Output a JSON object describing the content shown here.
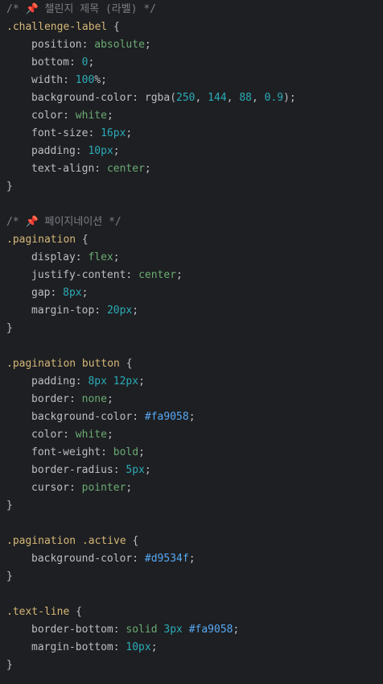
{
  "code": {
    "c1_open": "/* ",
    "c1_pin": "📌",
    "c1_text": " 챌린지 제목 (라벨) */",
    "sel1": ".challenge-label",
    "p_position": "position",
    "v_absolute": "absolute",
    "p_bottom": "bottom",
    "v_zero": "0",
    "p_width": "width",
    "v_100": "100",
    "v_pct": "%",
    "p_bgc": "background-color",
    "v_rgba": "rgba",
    "v_250": "250",
    "v_144": "144",
    "v_88": "88",
    "v_09": "0.9",
    "p_color": "color",
    "v_white": "white",
    "p_fontsize": "font-size",
    "v_16px": "16px",
    "p_padding": "padding",
    "v_10px": "10px",
    "p_textalign": "text-align",
    "v_center": "center",
    "c2_open": "/* ",
    "c2_pin": "📌",
    "c2_text": " 페이지네이션 */",
    "sel2": ".pagination",
    "p_display": "display",
    "v_flex": "flex",
    "p_justify": "justify-content",
    "p_gap": "gap",
    "v_8px": "8px",
    "p_margintop": "margin-top",
    "v_20px": "20px",
    "sel3": ".pagination button",
    "v_12px": "12px",
    "p_border": "border",
    "v_none": "none",
    "v_fa9058": "#fa9058",
    "p_fontweight": "font-weight",
    "v_bold": "bold",
    "p_radius": "border-radius",
    "v_5px": "5px",
    "p_cursor": "cursor",
    "v_pointer": "pointer",
    "sel4": ".pagination .active",
    "v_d9534f": "#d9534f",
    "sel5": ".text-line",
    "p_borderbottom": "border-bottom",
    "v_solid": "solid",
    "v_3px": "3px",
    "p_marginbottom": "margin-bottom"
  }
}
